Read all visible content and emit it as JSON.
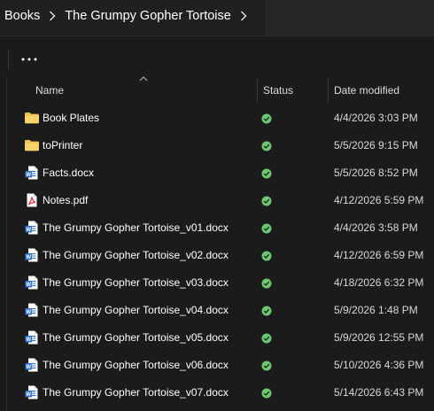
{
  "breadcrumb": {
    "items": [
      "Books",
      "The Grumpy Gopher Tortoise"
    ]
  },
  "command_bar": {
    "more_label": "..."
  },
  "columns": {
    "name": "Name",
    "status": "Status",
    "date_modified": "Date modified"
  },
  "files": [
    {
      "name": "Book Plates",
      "date": "4/4/2026 3:03 PM",
      "type": "folder",
      "icon": "folder-icon"
    },
    {
      "name": "toPrinter",
      "date": "5/5/2026 9:15 PM",
      "type": "folder",
      "icon": "folder-icon"
    },
    {
      "name": "Facts.docx",
      "date": "5/5/2026 8:52 PM",
      "type": "docx",
      "icon": "word-doc-icon"
    },
    {
      "name": "Notes.pdf",
      "date": "4/12/2026 5:59 PM",
      "type": "pdf",
      "icon": "pdf-icon"
    },
    {
      "name": "The Grumpy Gopher Tortoise_v01.docx",
      "date": "4/4/2026 3:58 PM",
      "type": "docx",
      "icon": "word-doc-icon"
    },
    {
      "name": "The Grumpy Gopher Tortoise_v02.docx",
      "date": "4/12/2026 6:59 PM",
      "type": "docx",
      "icon": "word-doc-icon"
    },
    {
      "name": "The Grumpy Gopher Tortoise_v03.docx",
      "date": "4/18/2026 6:32 PM",
      "type": "docx",
      "icon": "word-doc-icon"
    },
    {
      "name": "The Grumpy Gopher Tortoise_v04.docx",
      "date": "5/9/2026 1:48 PM",
      "type": "docx",
      "icon": "word-doc-icon"
    },
    {
      "name": "The Grumpy Gopher Tortoise_v05.docx",
      "date": "5/9/2026 12:55 PM",
      "type": "docx",
      "icon": "word-doc-icon"
    },
    {
      "name": "The Grumpy Gopher Tortoise_v06.docx",
      "date": "5/10/2026 4:36 PM",
      "type": "docx",
      "icon": "word-doc-icon"
    },
    {
      "name": "The Grumpy Gopher Tortoise_v07.docx",
      "date": "5/14/2026 6:43 PM",
      "type": "docx",
      "icon": "word-doc-icon"
    }
  ],
  "status_icon": "sync-ok-icon",
  "colors": {
    "background": "#1b1b1b",
    "folder": "#f0c24a",
    "word": "#2b6fd6",
    "pdf": "#e0312b",
    "status_ok": "#6cc870"
  }
}
